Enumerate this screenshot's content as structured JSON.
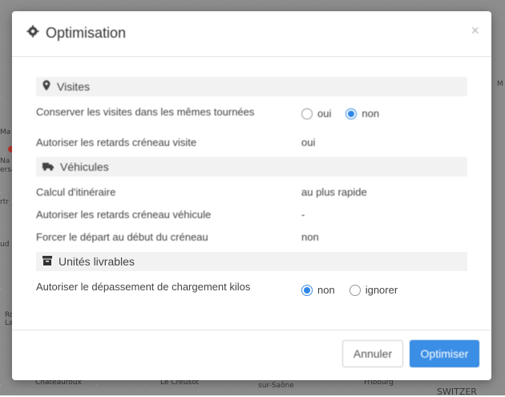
{
  "modal": {
    "title": "Optimisation",
    "close": "×",
    "sections": [
      {
        "title": "Visites",
        "icon": "map-marker-icon",
        "rows": [
          {
            "label": "Conserver les visites dans les mêmes tournées",
            "type": "radio",
            "options": [
              "oui",
              "non"
            ],
            "selected": "non"
          },
          {
            "label": "Autoriser les retards créneau visite",
            "type": "text",
            "value": "oui"
          }
        ]
      },
      {
        "title": "Véhicules",
        "icon": "truck-icon",
        "rows": [
          {
            "label": "Calcul d'itinéraire",
            "type": "text",
            "value": "au plus rapide"
          },
          {
            "label": "Autoriser les retards créneau véhicule",
            "type": "text",
            "value": "-"
          },
          {
            "label": "Forcer le départ au début du créneau",
            "type": "text",
            "value": "non"
          }
        ]
      },
      {
        "title": "Unités livrables",
        "icon": "box-icon",
        "rows": [
          {
            "label": "Autoriser le dépassement de chargement kilos",
            "type": "radio",
            "options": [
              "non",
              "ignorer"
            ],
            "selected": "non"
          }
        ]
      }
    ],
    "footer": {
      "cancel": "Annuler",
      "submit": "Optimiser"
    }
  },
  "map": {
    "labels": [
      "M",
      "Ma",
      "Na",
      "ersa",
      "rtr",
      "ud",
      "Ro",
      "La",
      "Châteauroux",
      "Le Creusot",
      "sur-Saône",
      "Fribourg",
      "SWITZER"
    ]
  },
  "colors": {
    "primary": "#3a8ee6",
    "section_bg": "#f2f2f2",
    "overlay": "#8d8d8d"
  }
}
